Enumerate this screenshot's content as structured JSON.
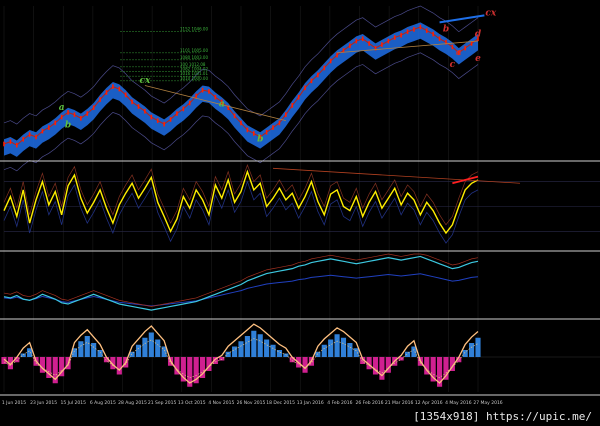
{
  "footer_text": "[1354x918] https://upic.me/",
  "colors": {
    "background": "#000000",
    "price_line": "#c02010",
    "price_thick": "#ff2000",
    "cloud": "#1e6fe8",
    "wave_label": "#5fbf3f",
    "wave_label_red": "#d03030",
    "oscillator": "#ffee00",
    "panel_divider": "#d0d0d0",
    "macd_line": "#3cc8e0",
    "hist_pos": "#3080d8",
    "hist_neg": "#d02090",
    "osc_line": "#ffc080"
  },
  "chart_data": [
    {
      "type": "line",
      "panel": "price",
      "series": [
        {
          "values": [
            72,
            74,
            71,
            76,
            80,
            78,
            83,
            86,
            90,
            95,
            99,
            97,
            94,
            98,
            103,
            110,
            116,
            121,
            119,
            114,
            108,
            104,
            100,
            95,
            92,
            89,
            93,
            98,
            102,
            107,
            113,
            118,
            117,
            112,
            108,
            103,
            96,
            90,
            84,
            81,
            78,
            82,
            86,
            90,
            97,
            105,
            112,
            120,
            126,
            131,
            137,
            143,
            148,
            152,
            156,
            160,
            162,
            158,
            154,
            157,
            160,
            163,
            165,
            168,
            170,
            172,
            169,
            166,
            162,
            159,
            155,
            150,
            154,
            158,
            162
          ]
        }
      ],
      "wave_labels": [
        {
          "text": "a",
          "t": 9,
          "v": 101
        },
        {
          "text": "b",
          "t": 10,
          "v": 86
        },
        {
          "text": "cx",
          "t": 22,
          "v": 124
        },
        {
          "text": "a",
          "t": 34,
          "v": 104
        },
        {
          "text": "b",
          "t": 40,
          "v": 74
        },
        {
          "text": "b",
          "t": 69,
          "v": 168
        },
        {
          "text": "a",
          "t": 71,
          "v": 148
        },
        {
          "text": "c",
          "t": 70,
          "v": 138
        },
        {
          "text": "e",
          "t": 74,
          "v": 143
        },
        {
          "text": "d",
          "t": 74,
          "v": 164
        },
        {
          "text": "cx",
          "t": 76,
          "v": 182
        }
      ],
      "fib_levels": [
        {
          "text": "1152 1046.00",
          "v": 168
        },
        {
          "text": "1101 1005.00",
          "v": 150
        },
        {
          "text": "1080 1003.00",
          "v": 144
        },
        {
          "text": "100 1012.08",
          "v": 138
        },
        {
          "text": "1082 1004.02",
          "v": 134
        },
        {
          "text": "1016 1001.01",
          "v": 130
        },
        {
          "text": "1010 1000.00",
          "v": 126
        }
      ]
    },
    {
      "type": "line",
      "panel": "oscillator",
      "ylim": [
        0,
        100
      ],
      "series": [
        {
          "values": [
            45,
            62,
            38,
            70,
            30,
            58,
            80,
            52,
            68,
            40,
            75,
            88,
            60,
            42,
            55,
            70,
            48,
            30,
            52,
            66,
            78,
            60,
            72,
            85,
            55,
            38,
            20,
            35,
            62,
            48,
            70,
            58,
            40,
            76,
            60,
            82,
            55,
            68,
            92,
            70,
            78,
            50,
            60,
            72,
            58,
            66,
            48,
            62,
            80,
            56,
            40,
            65,
            70,
            50,
            45,
            62,
            38,
            55,
            68,
            48,
            60,
            72,
            52,
            66,
            58,
            40,
            55,
            45,
            30,
            18,
            28,
            50,
            70,
            78,
            82
          ]
        }
      ]
    },
    {
      "type": "line",
      "panel": "macd",
      "series": [
        {
          "values": [
            30,
            28,
            32,
            26,
            24,
            28,
            34,
            30,
            26,
            20,
            18,
            22,
            26,
            30,
            34,
            30,
            26,
            22,
            18,
            16,
            14,
            12,
            10,
            8,
            10,
            12,
            14,
            16,
            18,
            20,
            22,
            26,
            30,
            34,
            38,
            42,
            46,
            50,
            56,
            60,
            64,
            68,
            70,
            72,
            74,
            76,
            80,
            82,
            86,
            88,
            90,
            92,
            90,
            88,
            86,
            84,
            86,
            88,
            90,
            92,
            94,
            92,
            90,
            92,
            94,
            96,
            92,
            88,
            84,
            80,
            76,
            78,
            82,
            86,
            88
          ]
        }
      ]
    },
    {
      "type": "bar",
      "panel": "histogram",
      "series": [
        {
          "values": [
            -8,
            -14,
            -6,
            4,
            10,
            -10,
            -18,
            -24,
            -30,
            -22,
            -14,
            10,
            18,
            24,
            16,
            8,
            -6,
            -14,
            -20,
            -12,
            6,
            14,
            22,
            28,
            20,
            12,
            -10,
            -20,
            -28,
            -34,
            -30,
            -24,
            -16,
            -8,
            -4,
            6,
            12,
            18,
            24,
            30,
            26,
            20,
            14,
            8,
            4,
            -6,
            -12,
            -18,
            -10,
            6,
            14,
            20,
            26,
            22,
            16,
            10,
            -8,
            -14,
            -20,
            -26,
            -18,
            -10,
            -4,
            6,
            12,
            -10,
            -20,
            -28,
            -34,
            -26,
            -16,
            -6,
            8,
            16,
            22
          ]
        }
      ]
    }
  ],
  "date_labels": [
    "1 Jun 2015",
    "23 Jun 2015",
    "15 Jul 2015",
    "6 Aug 2015",
    "28 Aug 2015",
    "21 Sep 2015",
    "13 Oct 2015",
    "4 Nov 2015",
    "26 Nov 2015",
    "18 Dec 2015",
    "13 Jan 2016",
    "4 Feb 2016",
    "26 Feb 2016",
    "21 Mar 2016",
    "12 Apr 2016",
    "4 May 2016",
    "27 May 2016"
  ]
}
